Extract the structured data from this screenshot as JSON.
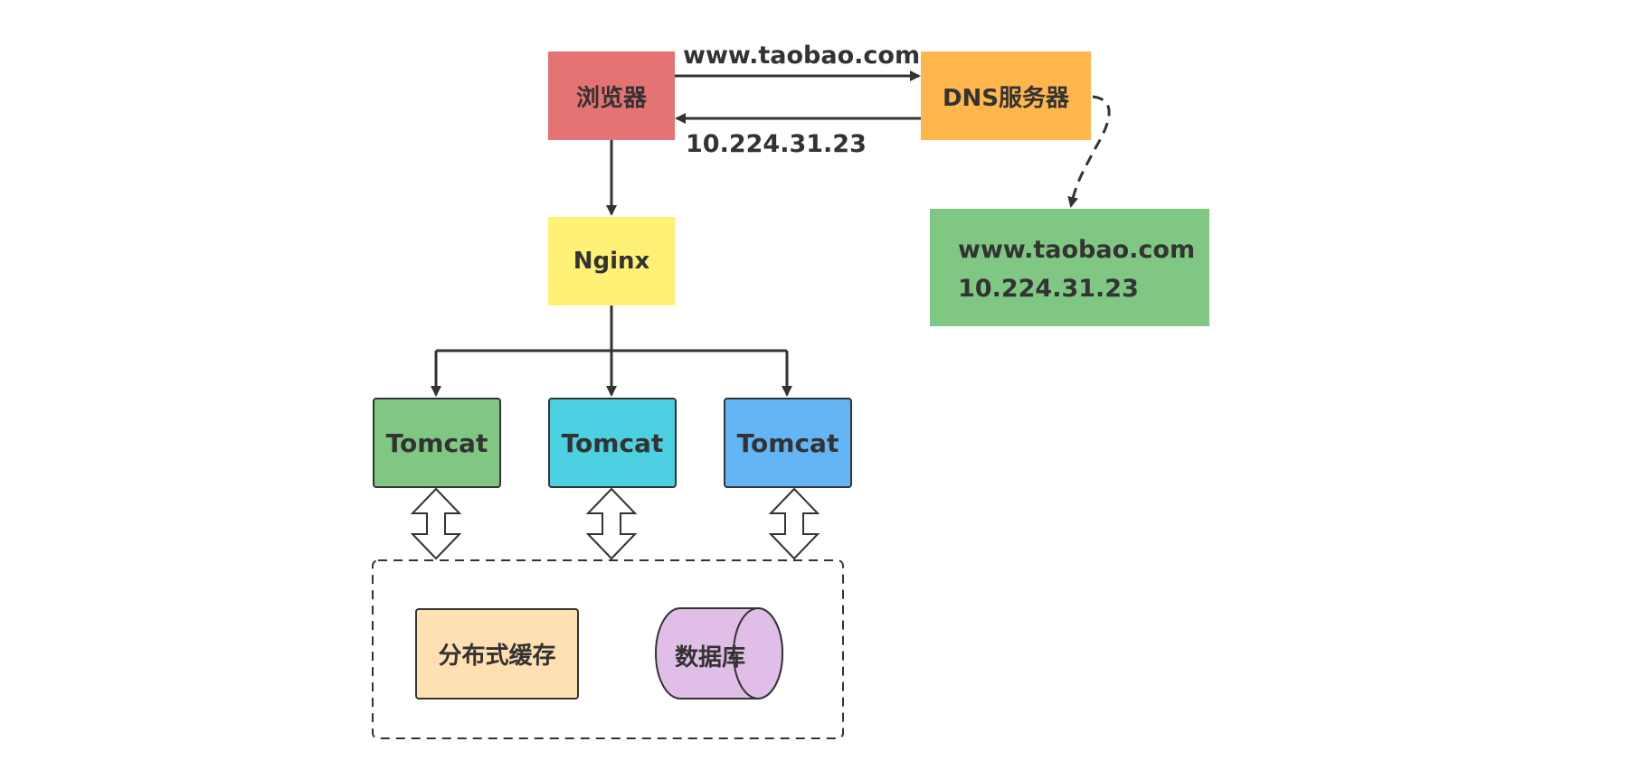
{
  "colors": {
    "browser": "#e57373",
    "dns": "#ffb74d",
    "nginx": "#fff176",
    "dns_record": "#81c784",
    "tomcat_1": "#81c784",
    "tomcat_2": "#4dd0e1",
    "tomcat_3": "#64b5f6",
    "cache": "#ffe0b2",
    "database": "#e1bee7",
    "stroke": "#333333"
  },
  "nodes": {
    "browser": "浏览器",
    "dns_server": "DNS服务器",
    "nginx": "Nginx",
    "dns_record": {
      "domain": "www.taobao.com",
      "ip": "10.224.31.23"
    },
    "tomcats": [
      "Tomcat",
      "Tomcat",
      "Tomcat"
    ],
    "cache": "分布式缓存",
    "database": "数据库"
  },
  "edges": {
    "request_label": "www.taobao.com",
    "response_label": "10.224.31.23"
  }
}
